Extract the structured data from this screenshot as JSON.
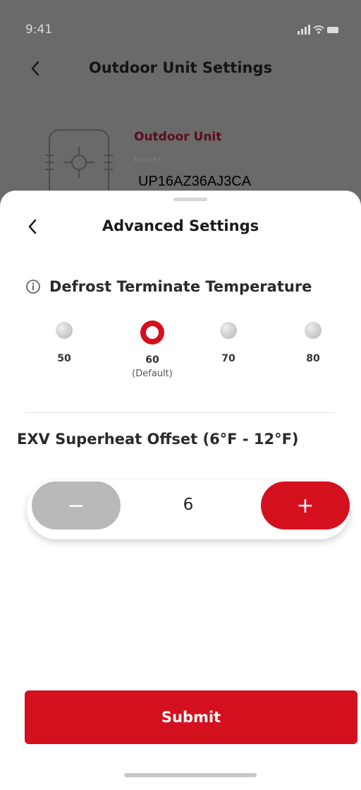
{
  "status": {
    "time": "9:41"
  },
  "background": {
    "title": "Outdoor Unit Settings",
    "unit": {
      "name": "Outdoor Unit",
      "model_label": "MODEL",
      "model": "UP16AZ36AJ3CA"
    }
  },
  "sheet": {
    "title": "Advanced Settings",
    "defrost": {
      "title": "Defrost Terminate Temperature",
      "options": [
        {
          "value": "50",
          "note": ""
        },
        {
          "value": "60",
          "note": "(Default)"
        },
        {
          "value": "70",
          "note": ""
        },
        {
          "value": "80",
          "note": ""
        }
      ],
      "selected": "60"
    },
    "exv": {
      "title": "EXV Superheat Offset (6°F - 12°F)",
      "value": "6",
      "minus_label": "−",
      "plus_label": "+"
    },
    "submit_label": "Submit"
  },
  "colors": {
    "accent": "#d4101f",
    "disabled": "#b9b9b9"
  },
  "icons": [
    "back-chevron-icon",
    "info-icon",
    "signal-icon",
    "wifi-icon",
    "battery-icon",
    "outdoor-unit-icon"
  ]
}
